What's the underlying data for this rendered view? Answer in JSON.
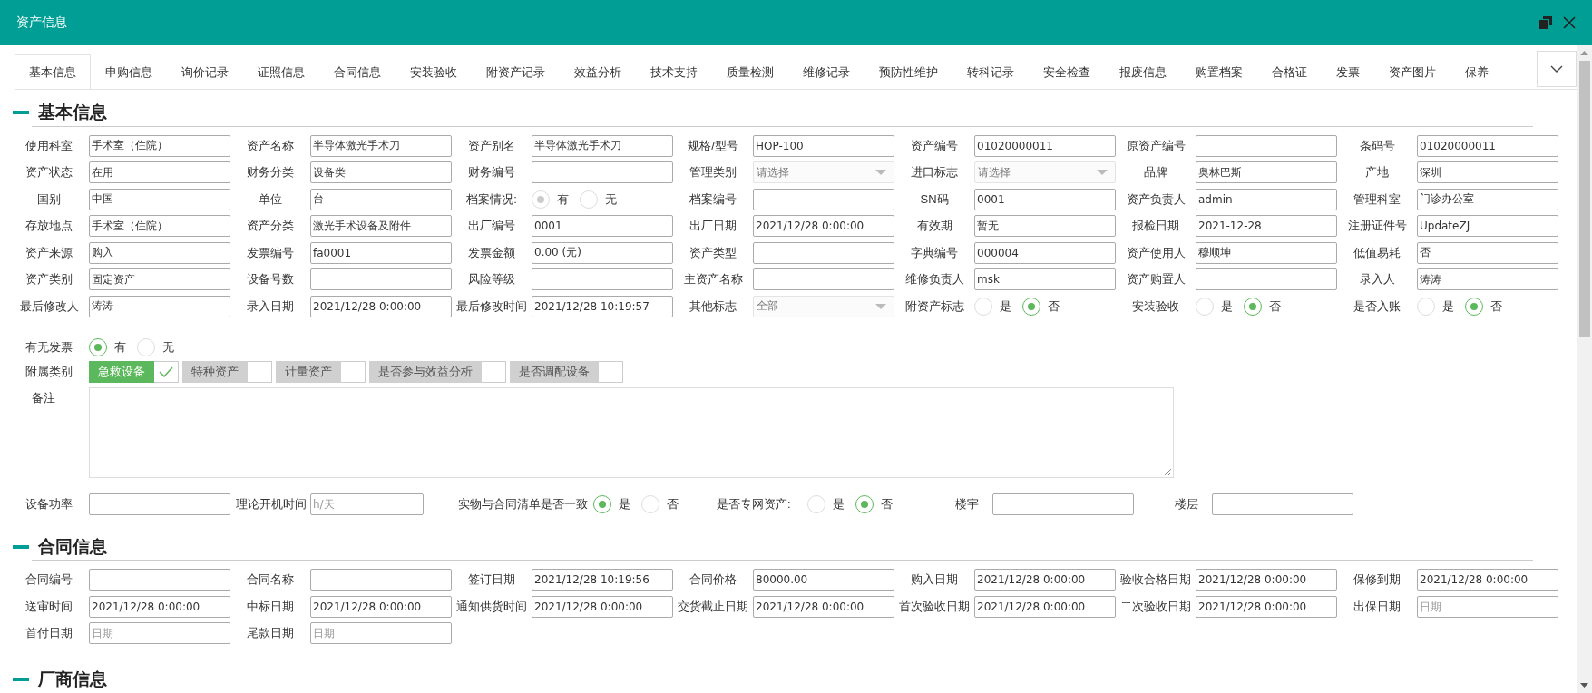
{
  "window": {
    "title": "资产信息"
  },
  "tabs": [
    {
      "label": "基本信息",
      "selected": true
    },
    {
      "label": "申购信息",
      "selected": false
    },
    {
      "label": "询价记录",
      "selected": false
    },
    {
      "label": "证照信息",
      "selected": false
    },
    {
      "label": "合同信息",
      "selected": false
    },
    {
      "label": "安装验收",
      "selected": false
    },
    {
      "label": "附资产记录",
      "selected": false
    },
    {
      "label": "效益分析",
      "selected": false
    },
    {
      "label": "技术支持",
      "selected": false
    },
    {
      "label": "质量检测",
      "selected": false
    },
    {
      "label": "维修记录",
      "selected": false
    },
    {
      "label": "预防性维护",
      "selected": false
    },
    {
      "label": "转科记录",
      "selected": false
    },
    {
      "label": "安全检查",
      "selected": false
    },
    {
      "label": "报废信息",
      "selected": false
    },
    {
      "label": "购置档案",
      "selected": false
    },
    {
      "label": "合格证",
      "selected": false
    },
    {
      "label": "发票",
      "selected": false
    },
    {
      "label": "资产图片",
      "selected": false
    },
    {
      "label": "保养",
      "selected": false
    }
  ],
  "basic_info": {
    "title": "基本信息",
    "fields": [
      {
        "label": "使用科室",
        "kind": "input",
        "value": "手术室（住院）"
      },
      {
        "label": "资产名称",
        "kind": "input",
        "value": "半导体激光手术刀"
      },
      {
        "label": "资产别名",
        "kind": "input",
        "value": "半导体激光手术刀"
      },
      {
        "label": "规格/型号",
        "kind": "input",
        "value": "HOP-100"
      },
      {
        "label": "资产编号",
        "kind": "input",
        "value": "01020000011"
      },
      {
        "label": "原资产编号",
        "kind": "input"
      },
      {
        "label": "条码号",
        "kind": "input",
        "value": "01020000011"
      },
      {
        "label": "资产状态",
        "kind": "input",
        "value": "在用"
      },
      {
        "label": "财务分类",
        "kind": "input",
        "value": "设备类"
      },
      {
        "label": "财务编号",
        "kind": "input"
      },
      {
        "label": "管理类别",
        "kind": "select",
        "placeholder": "请选择"
      },
      {
        "label": "进口标志",
        "kind": "select",
        "placeholder": "请选择"
      },
      {
        "label": "品牌",
        "kind": "input",
        "value": "奥林巴斯"
      },
      {
        "label": "产地",
        "kind": "input",
        "value": "深圳"
      },
      {
        "label": "国别",
        "kind": "input",
        "value": "中国"
      },
      {
        "label": "单位",
        "kind": "input",
        "value": "台"
      },
      {
        "label": "档案情况:",
        "kind": "radio",
        "disabled": true,
        "options": [
          {
            "label": "有",
            "selected": true
          },
          {
            "label": "无",
            "selected": false
          }
        ]
      },
      {
        "label": "档案编号",
        "kind": "input"
      },
      {
        "label": "SN码",
        "kind": "input",
        "value": "0001"
      },
      {
        "label": "资产负责人",
        "kind": "input",
        "value": "admin"
      },
      {
        "label": "管理科室",
        "kind": "input",
        "value": "门诊办公室"
      },
      {
        "label": "存放地点",
        "kind": "input",
        "value": "手术室（住院）"
      },
      {
        "label": "资产分类",
        "kind": "input",
        "value": "激光手术设备及附件"
      },
      {
        "label": "出厂编号",
        "kind": "input",
        "value": "0001"
      },
      {
        "label": "出厂日期",
        "kind": "input",
        "value": "2021/12/28 0:00:00"
      },
      {
        "label": "有效期",
        "kind": "input",
        "value": "暂无"
      },
      {
        "label": "报检日期",
        "kind": "input",
        "value": "2021-12-28"
      },
      {
        "label": "注册证件号",
        "kind": "input",
        "value": "UpdateZJ"
      },
      {
        "label": "资产来源",
        "kind": "input",
        "value": "购入"
      },
      {
        "label": "发票编号",
        "kind": "input",
        "value": "fa0001"
      },
      {
        "label": "发票金额",
        "kind": "input",
        "value": "0.00 (元)"
      },
      {
        "label": "资产类型",
        "kind": "input"
      },
      {
        "label": "字典编号",
        "kind": "input",
        "value": "000004"
      },
      {
        "label": "资产使用人",
        "kind": "input",
        "value": "穆顺坤"
      },
      {
        "label": "低值易耗",
        "kind": "input",
        "value": "否"
      },
      {
        "label": "资产类别",
        "kind": "input",
        "value": "固定资产"
      },
      {
        "label": "设备号数",
        "kind": "input"
      },
      {
        "label": "风险等级",
        "kind": "input"
      },
      {
        "label": "主资产名称",
        "kind": "input"
      },
      {
        "label": "维修负责人",
        "kind": "input",
        "value": "msk"
      },
      {
        "label": "资产购置人",
        "kind": "input"
      },
      {
        "label": "录入人",
        "kind": "input",
        "value": "涛涛"
      },
      {
        "label": "最后修改人",
        "kind": "input",
        "value": "涛涛"
      },
      {
        "label": "录入日期",
        "kind": "input",
        "value": "2021/12/28 0:00:00"
      },
      {
        "label": "最后修改时间",
        "kind": "input",
        "value": "2021/12/28 10:19:57"
      },
      {
        "label": "其他标志",
        "kind": "select",
        "value": "全部"
      },
      {
        "label": "附资产标志",
        "kind": "radio",
        "disabled": false,
        "options": [
          {
            "label": "是",
            "selected": false
          },
          {
            "label": "否",
            "selected": true
          }
        ]
      },
      {
        "label": "安装验收",
        "kind": "radio",
        "disabled": false,
        "options": [
          {
            "label": "是",
            "selected": false
          },
          {
            "label": "否",
            "selected": true
          }
        ]
      },
      {
        "label": "是否入账",
        "kind": "radio",
        "disabled": false,
        "options": [
          {
            "label": "是",
            "selected": false
          },
          {
            "label": "否",
            "selected": true
          }
        ]
      }
    ],
    "invoice": {
      "label": "有无发票",
      "kind": "radio",
      "disabled": false,
      "options": [
        {
          "label": "有",
          "selected": true
        },
        {
          "label": "无",
          "selected": false
        }
      ]
    },
    "attached_categories": {
      "label": "附属类别",
      "items": [
        {
          "label": "急救设备",
          "checked": true
        },
        {
          "label": "特种资产",
          "checked": false
        },
        {
          "label": "计量资产",
          "checked": false
        },
        {
          "label": "是否参与效益分析",
          "checked": false
        },
        {
          "label": "是否调配设备",
          "checked": false
        }
      ]
    },
    "remarks": {
      "label": "备注"
    },
    "extra_fields": [
      {
        "label": "设备功率",
        "kind": "input"
      },
      {
        "label": "理论开机时间",
        "kind": "input",
        "placeholder": "h/天"
      },
      {
        "label": "实物与合同清单是否一致",
        "kind": "radio",
        "disabled": false,
        "options": [
          {
            "label": "是",
            "selected": true
          },
          {
            "label": "否",
            "selected": false
          }
        ]
      },
      {
        "label": "是否专网资产:",
        "kind": "radio",
        "disabled": false,
        "options": [
          {
            "label": "是",
            "selected": false
          },
          {
            "label": "否",
            "selected": true
          }
        ]
      },
      {
        "label": "楼宇",
        "kind": "input"
      },
      {
        "label": "楼层",
        "kind": "input"
      }
    ]
  },
  "contract_info": {
    "title": "合同信息",
    "fields": [
      {
        "label": "合同编号",
        "kind": "input"
      },
      {
        "label": "合同名称",
        "kind": "input"
      },
      {
        "label": "签订日期",
        "kind": "input",
        "value": "2021/12/28 10:19:56"
      },
      {
        "label": "合同价格",
        "kind": "input",
        "value": "80000.00"
      },
      {
        "label": "购入日期",
        "kind": "input",
        "value": "2021/12/28 0:00:00"
      },
      {
        "label": "验收合格日期",
        "kind": "input",
        "value": "2021/12/28 0:00:00"
      },
      {
        "label": "保修到期",
        "kind": "input",
        "value": "2021/12/28 0:00:00"
      },
      {
        "label": "送审时间",
        "kind": "input",
        "value": "2021/12/28 0:00:00"
      },
      {
        "label": "中标日期",
        "kind": "input",
        "value": "2021/12/28 0:00:00"
      },
      {
        "label": "通知供货时间",
        "kind": "input",
        "value": "2021/12/28 0:00:00"
      },
      {
        "label": "交货截止日期",
        "kind": "input",
        "value": "2021/12/28 0:00:00"
      },
      {
        "label": "首次验收日期",
        "kind": "input",
        "value": "2021/12/28 0:00:00"
      },
      {
        "label": "二次验收日期",
        "kind": "input",
        "value": "2021/12/28 0:00:00"
      },
      {
        "label": "出保日期",
        "kind": "input",
        "placeholder": "日期"
      },
      {
        "label": "首付日期",
        "kind": "input",
        "placeholder": "日期"
      },
      {
        "label": "尾款日期",
        "kind": "input",
        "placeholder": "日期"
      }
    ]
  },
  "vendor_info": {
    "title": "厂商信息"
  }
}
